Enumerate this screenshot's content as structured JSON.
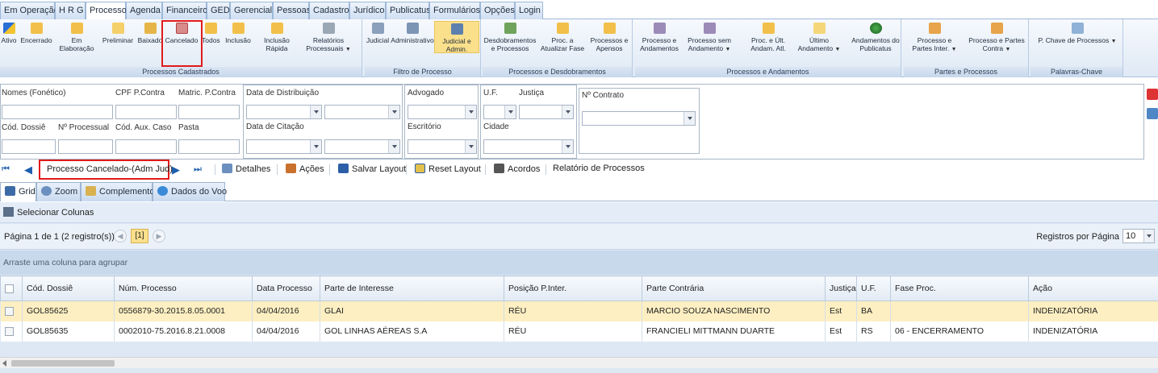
{
  "menu": {
    "tabs": [
      "Em Operação",
      "H R G",
      "Processo",
      "Agenda",
      "Financeiro",
      "GED",
      "Gerencial",
      "Pessoas",
      "Cadastro",
      "Jurídico",
      "Publicatus",
      "Formulários",
      "Opções",
      "Login"
    ],
    "active": "Processo"
  },
  "ribbon": {
    "cadastrados": {
      "caption": "Processos Cadastrados",
      "buttons": [
        "Ativo",
        "Encerrado",
        "Em Elaboração",
        "Preliminar",
        "Baixado",
        "Cancelado",
        "Todos",
        "Inclusão",
        "Inclusão Rápida",
        "Relatórios Processuais"
      ]
    },
    "filtro": {
      "caption": "Filtro de Processo",
      "buttons": [
        "Judicial",
        "Administrativo",
        "Judicial e Admin."
      ]
    },
    "desdobramentos": {
      "caption": "Processos e Desdobramentos",
      "buttons": [
        "Desdobramentos e Processos",
        "Proc. a Atualizar Fase",
        "Processos e Apensos"
      ]
    },
    "andamentos": {
      "caption": "Processos e Andamentos",
      "buttons": [
        "Processo e Andamentos",
        "Processo sem Andamento",
        "Proc. e Últ. Andam. Atl.",
        "Último Andamento",
        "Andamentos do Publicatus"
      ]
    },
    "partes": {
      "caption": "Partes e Processos",
      "buttons": [
        "Processo e Partes Inter.",
        "Processo e Partes Contra"
      ]
    },
    "palavras": {
      "caption": "Palavras-Chave",
      "buttons": [
        "P. Chave de Processos"
      ]
    }
  },
  "filters": {
    "nomes": "Nomes (Fonético)",
    "cpf": "CPF P.Contra",
    "matric": "Matric. P.Contra",
    "cod_dossie": "Cód. Dossiê",
    "num_processual": "Nº Processual",
    "cod_aux": "Cód. Aux. Caso",
    "pasta": "Pasta",
    "data_distribuicao": "Data de Distribuição",
    "data_citacao": "Data de Citação",
    "advogado": "Advogado",
    "escritorio": "Escritório",
    "uf": "U.F.",
    "justica": "Justiça",
    "cidade": "Cidade",
    "contrato": "Nº Contrato"
  },
  "toolbar": {
    "current_view": "Processo Cancelado-(Adm Jud)",
    "detalhes": "Detalhes",
    "acoes": "Ações",
    "salvar_layout": "Salvar Layout",
    "reset_layout": "Reset Layout",
    "acordos": "Acordos",
    "relatorio": "Relatório de Processos"
  },
  "view_tabs": [
    "Grid",
    "Zoom",
    "Complemento",
    "Dados do Voo"
  ],
  "grid": {
    "select_columns": "Selecionar Colunas",
    "page_info": "Página 1 de 1 (2 registro(s))",
    "current_page": "[1]",
    "per_page_label": "Registros por Página",
    "per_page_value": "10",
    "group_hint": "Arraste uma coluna para agrupar",
    "columns": [
      "Cód. Dossiê",
      "Núm. Processo",
      "Data Processo",
      "Parte de Interesse",
      "Posição P.Inter.",
      "Parte Contrária",
      "Justiça",
      "U.F.",
      "Fase Proc.",
      "Ação"
    ],
    "rows": [
      [
        "GOL85625",
        "0556879-30.2015.8.05.0001",
        "04/04/2016",
        "GLAI",
        "RÉU",
        "MARCIO SOUZA NASCIMENTO",
        "Est",
        "BA",
        "",
        "INDENIZATÓRIA"
      ],
      [
        "GOL85635",
        "0002010-75.2016.8.21.0008",
        "04/04/2016",
        "GOL LINHAS AÉREAS S.A",
        "RÉU",
        "FRANCIELI MITTMANN DUARTE",
        "Est",
        "RS",
        "06 - ENCERRAMENTO",
        "INDENIZATÓRIA"
      ]
    ]
  },
  "colors": {
    "highlight_row": "#fdefc2",
    "selected_button": "#fbe08c",
    "annotation_red": "#e11a1a",
    "accent_blue": "#9db8d8"
  }
}
